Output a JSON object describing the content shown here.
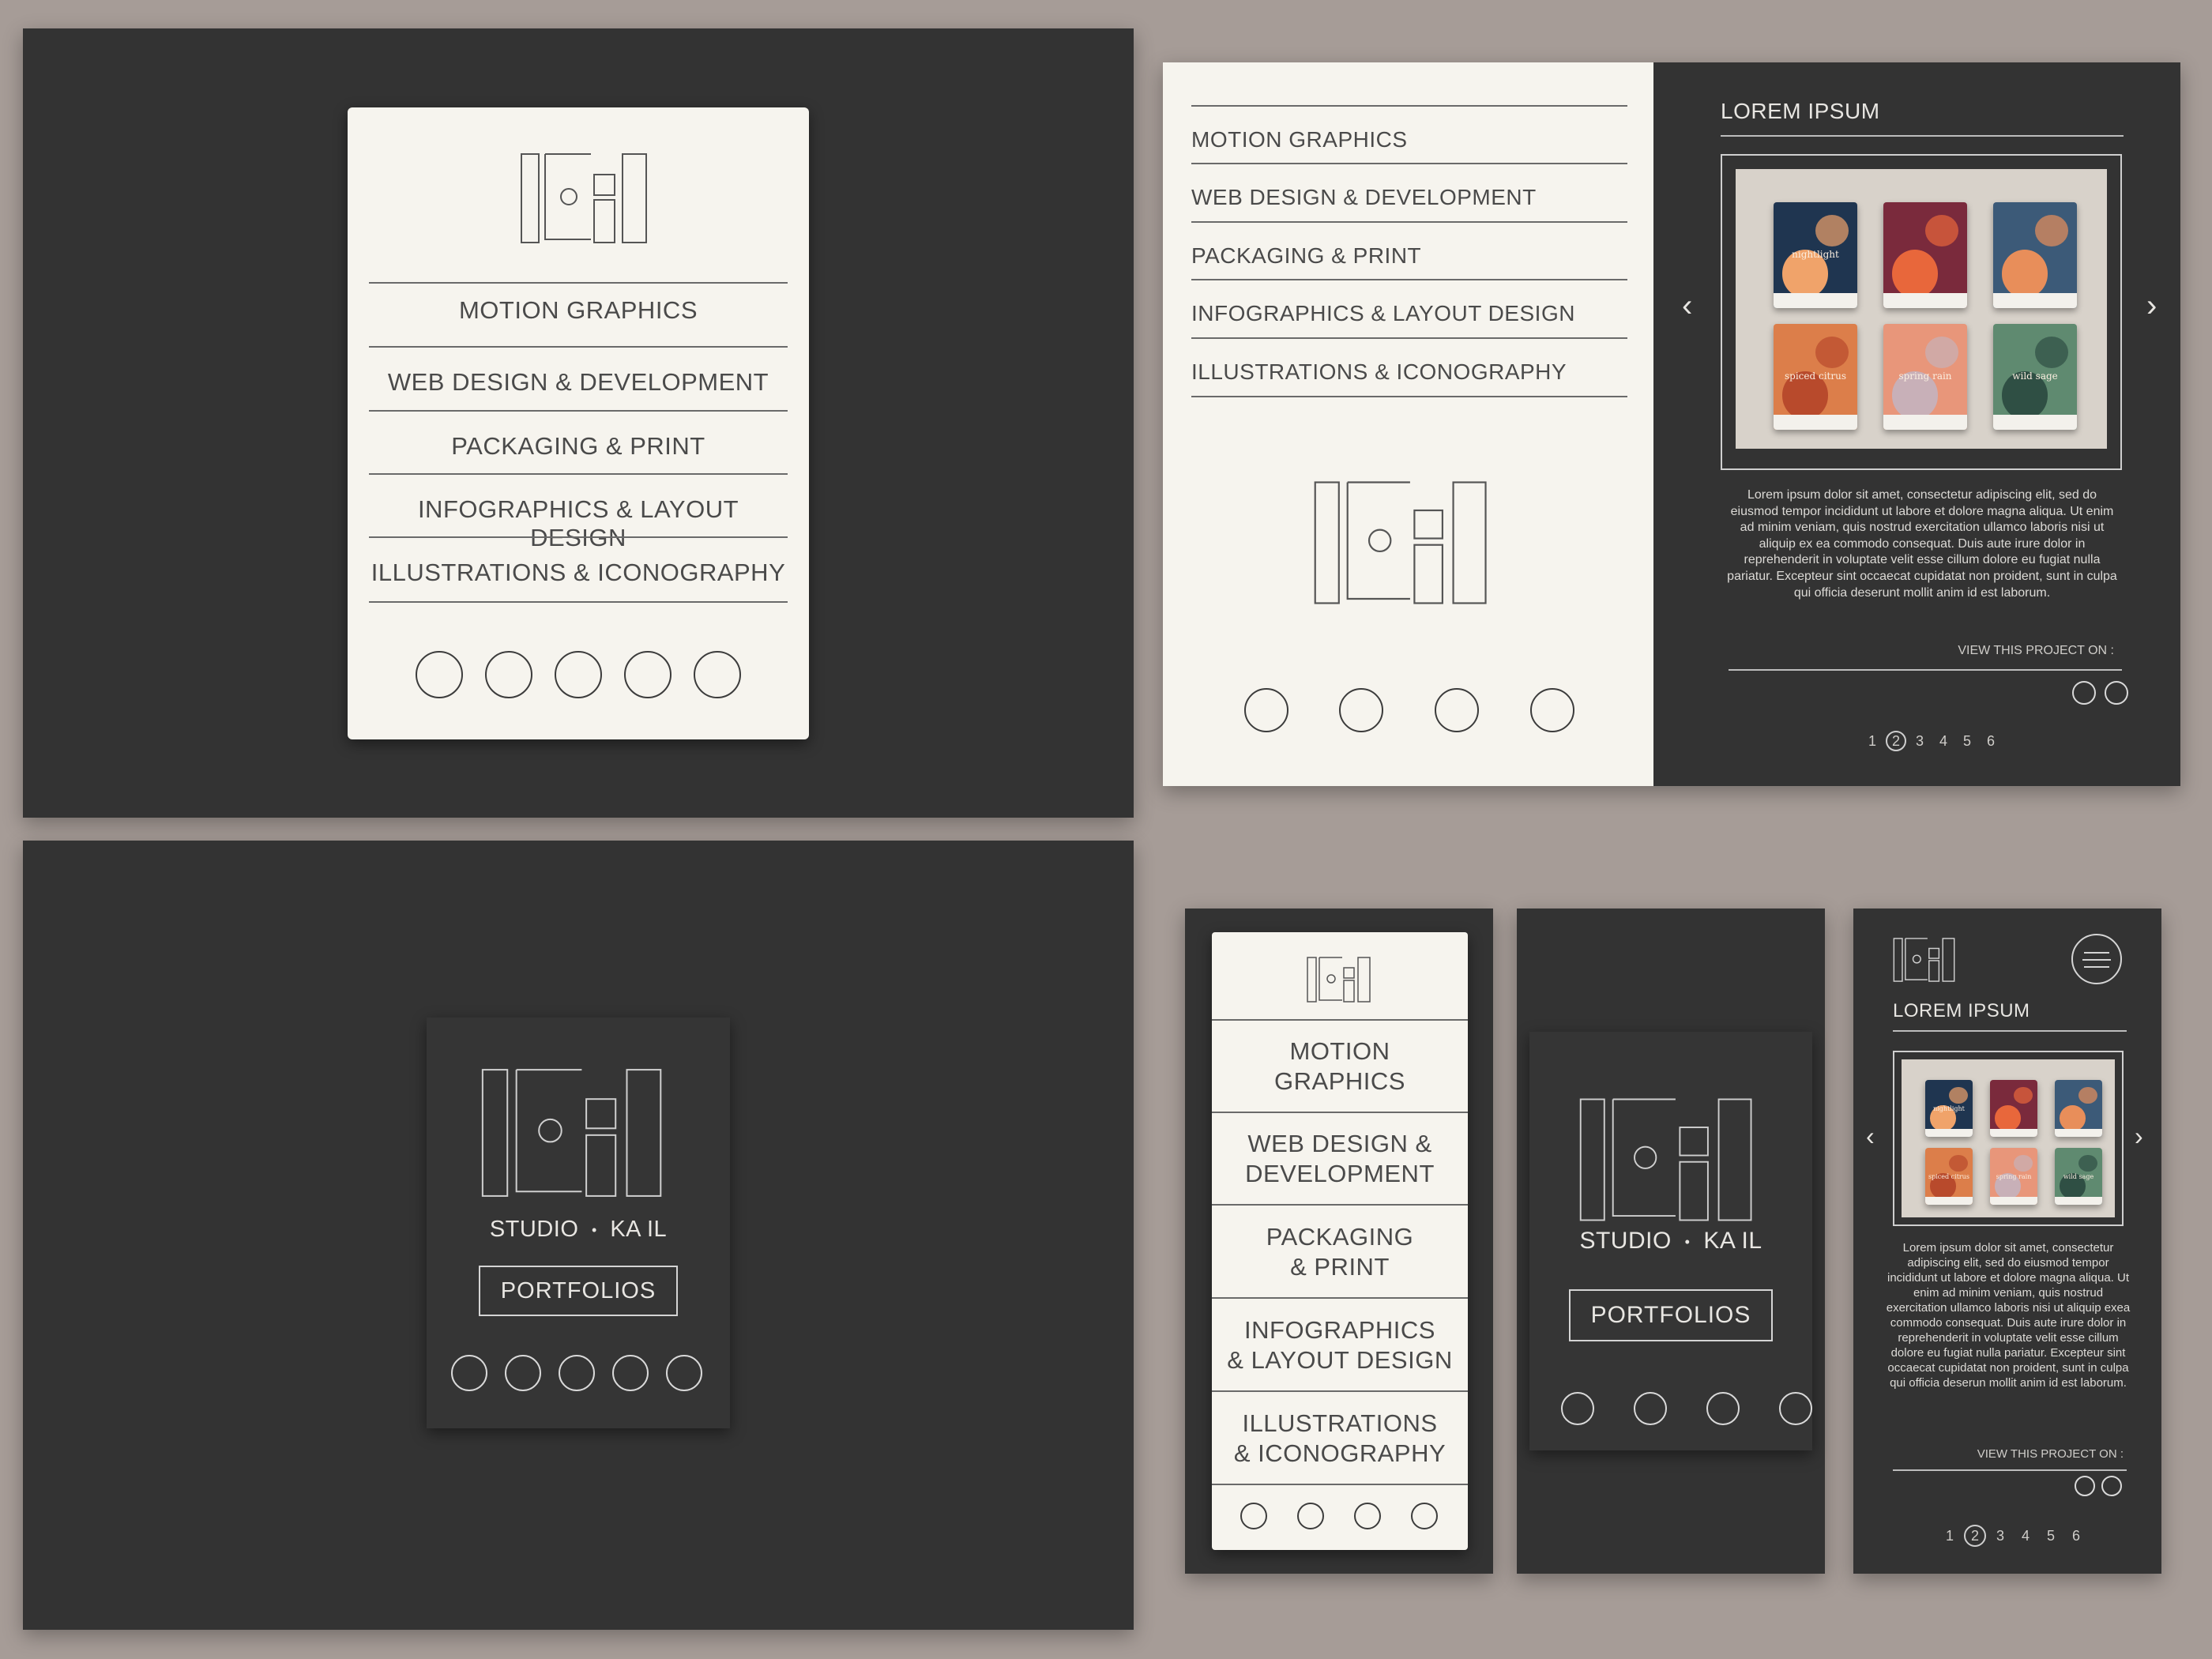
{
  "brand": {
    "name_left": "STUDIO",
    "separator": "•",
    "name_right": "KA IL"
  },
  "menu": [
    "MOTION GRAPHICS",
    "WEB DESIGN & DEVELOPMENT",
    "PACKAGING & PRINT",
    "INFOGRAPHICS & LAYOUT DESIGN",
    "ILLUSTRATIONS & ICONOGRAPHY"
  ],
  "mobile_menu": [
    {
      "line1": "MOTION",
      "line2": "GRAPHICS"
    },
    {
      "line1": "WEB DESIGN &",
      "line2": "DEVELOPMENT"
    },
    {
      "line1": "PACKAGING",
      "line2": "& PRINT"
    },
    {
      "line1": "INFOGRAPHICS",
      "line2": "& LAYOUT DESIGN"
    },
    {
      "line1": "ILLUSTRATIONS",
      "line2": "& ICONOGRAPHY"
    }
  ],
  "portfolios_button": "PORTFOLIOS",
  "project": {
    "title": "LOREM IPSUM",
    "description": "Lorem ipsum dolor sit amet, consectetur adipiscing elit,  sed do eiusmod tempor incididunt ut labore et dolore magna aliqua. Ut enim ad minim veniam, quis nostrud exercitation ullamco laboris nisi ut aliquip ex ea commodo consequat. Duis aute irure dolor in reprehenderit in voluptate velit esse cillum dolore eu fugiat nulla pariatur. Excepteur sint occaecat cupidatat non proident, sunt in culpa qui officia deserunt mollit anim id est laborum.",
    "description_mobile": "Lorem ipsum dolor sit amet, consectetur adipiscing elit,  sed do eiusmod tempor incididunt ut labore et dolore magna aliqua. Ut enim ad minim veniam, quis nostrud exercitation ullamco laboris nisi ut aliquip exea commodo consequat. Duis aute irure dolor in reprehenderit in voluptate velit esse cillum dolore eu fugiat nulla pariatur. Excepteur sint occaecat cupidatat non proident, sunt in culpa qui officia deserun mollit anim id est laborum.",
    "view_on": "VIEW THIS PROJECT ON :",
    "pages": [
      "1",
      "2",
      "3",
      "4",
      "5",
      "6"
    ],
    "current_page": "2",
    "products": [
      {
        "label": "nightlight",
        "bg": "#1f3550",
        "accent": "#f0a36a"
      },
      {
        "label": "",
        "bg": "#7a2a3c",
        "accent": "#e8673b"
      },
      {
        "label": "",
        "bg": "#3c5a78",
        "accent": "#e88e5a"
      },
      {
        "label": "spiced citrus",
        "bg": "#dc7e4a",
        "accent": "#b84a2c"
      },
      {
        "label": "spring rain",
        "bg": "#e8967a",
        "accent": "#c8b0b8"
      },
      {
        "label": "wild sage",
        "bg": "#5f8a70",
        "accent": "#2f4f44"
      }
    ]
  },
  "icons": {
    "prev": "‹",
    "next": "›"
  },
  "colors": {
    "page_bg": "#a69c97",
    "dark_panel": "#333333",
    "light_panel": "#f6f4ee"
  }
}
